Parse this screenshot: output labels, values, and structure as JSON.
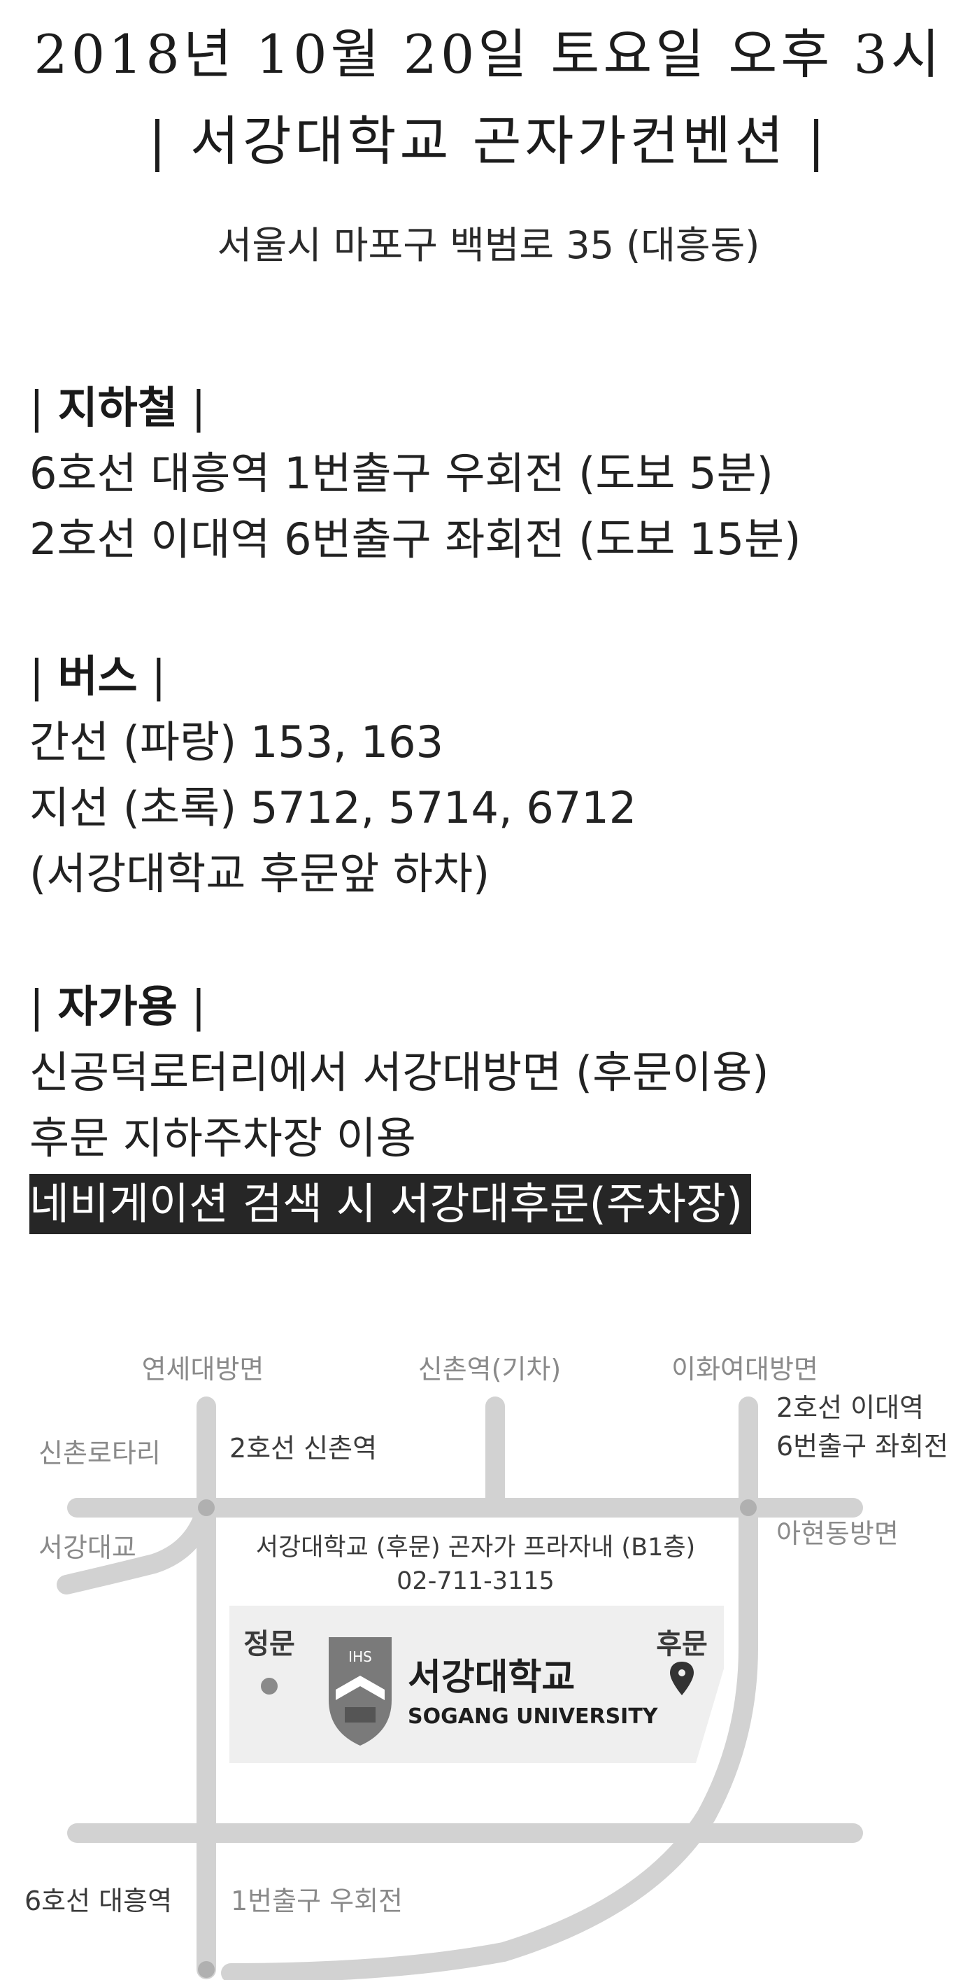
{
  "header": {
    "date_line": "2018년 10월 20일 토요일 오후 3시",
    "venue_line": "| 서강대학교 곤자가컨벤션 |",
    "address": "서울시 마포구 백범로 35 (대흥동)"
  },
  "subway": {
    "title": "지하철",
    "lines": [
      "6호선 대흥역 1번출구 우회전 (도보 5분)",
      "2호선 이대역 6번출구 좌회전 (도보 15분)"
    ]
  },
  "bus": {
    "title": "버스",
    "lines": [
      "간선 (파랑) 153, 163",
      "지선 (초록) 5712, 5714, 6712",
      "(서강대학교 후문앞 하차)"
    ]
  },
  "car": {
    "title": "자가용",
    "lines": [
      "신공덕로터리에서 서강대방면 (후문이용)",
      "후문 지하주차장 이용"
    ],
    "highlight": "네비게이션 검색 시 서강대후문(주차장)"
  },
  "map": {
    "labels": {
      "yonsei": "연세대방면",
      "sinchon_train": "신촌역(기차)",
      "ewha": "이화여대방면",
      "ewha_station_1": "2호선 이대역",
      "ewha_station_2": "6번출구 좌회전",
      "sinchon_rotary": "신촌로타리",
      "sinchon_station": "2호선 신촌역",
      "sogang_bridge": "서강대교",
      "ahyeon": "아현동방면",
      "venue": "서강대학교 (후문)  곤자가 프라자내 (B1층)",
      "phone": "02-711-3115",
      "main_gate": "정문",
      "back_gate": "후문",
      "daeheung": "6호선 대흥역",
      "exit1": "1번출구 우회전",
      "logo_kr": "서강대학교",
      "logo_en": "SOGANG UNIVERSITY",
      "crest_text": "IHS"
    },
    "colors": {
      "road": "#d2d2d2",
      "campus": "#efefef",
      "label": "#8a8a8a",
      "dark_label": "#3a3a3a"
    }
  }
}
